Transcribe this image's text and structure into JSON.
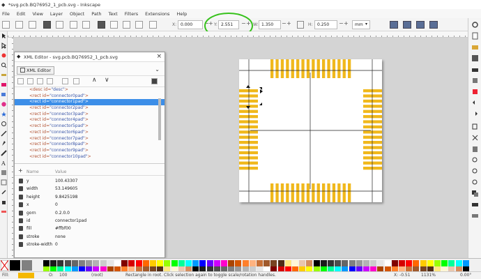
{
  "window": {
    "title": "*svg.pcb.BQ76952_1_pcb.svg - Inkscape"
  },
  "menu": [
    "File",
    "Edit",
    "View",
    "Layer",
    "Object",
    "Path",
    "Text",
    "Filters",
    "Extensions",
    "Help"
  ],
  "toolbar": {
    "x_label": "X:",
    "x_value": "0.000",
    "y_label": "Y:",
    "y_value": "2.551",
    "w_label": "W:",
    "w_value": "1.350",
    "h_label": "H:",
    "h_value": "0.250",
    "unit": "mm",
    "plus": "+",
    "minus": "−"
  },
  "xml_editor": {
    "title": "XML Editor - svg.pcb.BQ76952_1_pcb.svg",
    "tab_label": "XML Editor",
    "nodes": [
      {
        "prefix": "<desc id=",
        "id": "\"desc\"",
        "suffix": ">"
      },
      {
        "prefix": "<rect id=",
        "id": "\"connector0pad\"",
        "suffix": ">"
      },
      {
        "prefix": "<rect id=",
        "id": "\"connector1pad\"",
        "suffix": ">",
        "selected": true
      },
      {
        "prefix": "<rect id=",
        "id": "\"connector2pad\"",
        "suffix": ">"
      },
      {
        "prefix": "<rect id=",
        "id": "\"connector3pad\"",
        "suffix": ">"
      },
      {
        "prefix": "<rect id=",
        "id": "\"connector4pad\"",
        "suffix": ">"
      },
      {
        "prefix": "<rect id=",
        "id": "\"connector5pad\"",
        "suffix": ">"
      },
      {
        "prefix": "<rect id=",
        "id": "\"connector6pad\"",
        "suffix": ">"
      },
      {
        "prefix": "<rect id=",
        "id": "\"connector7pad\"",
        "suffix": ">"
      },
      {
        "prefix": "<rect id=",
        "id": "\"connector8pad\"",
        "suffix": ">"
      },
      {
        "prefix": "<rect id=",
        "id": "\"connector9pad\"",
        "suffix": ">"
      },
      {
        "prefix": "<rect id=",
        "id": "\"connector10pad\"",
        "suffix": ">"
      }
    ],
    "attr_header": {
      "name": "Name",
      "value": "Value",
      "add": "+"
    },
    "attributes": [
      {
        "name": "y",
        "value": "100.43307"
      },
      {
        "name": "width",
        "value": "53.149605"
      },
      {
        "name": "height",
        "value": "9.8425198"
      },
      {
        "name": "x",
        "value": "0"
      },
      {
        "name": "gorn",
        "value": "0.2.0.0"
      },
      {
        "name": "id",
        "value": "connector1pad"
      },
      {
        "name": "fill",
        "value": "#ffbf00"
      },
      {
        "name": "stroke",
        "value": "none"
      },
      {
        "name": "stroke-width",
        "value": "0"
      }
    ]
  },
  "status": {
    "fill_label": "Fill:",
    "stroke_label": "O:",
    "opacity": "100",
    "layer": "(root)",
    "message": "Rectangle in root. Click selection again to toggle scale/rotation handles.",
    "cursor_x": "X: -0.51",
    "zoom": "1131%",
    "rotation": "0.00°"
  },
  "colors": {
    "pad": "#f0b81c",
    "selection": "#3c8ee8",
    "annotation_circle": "#37c21c"
  }
}
